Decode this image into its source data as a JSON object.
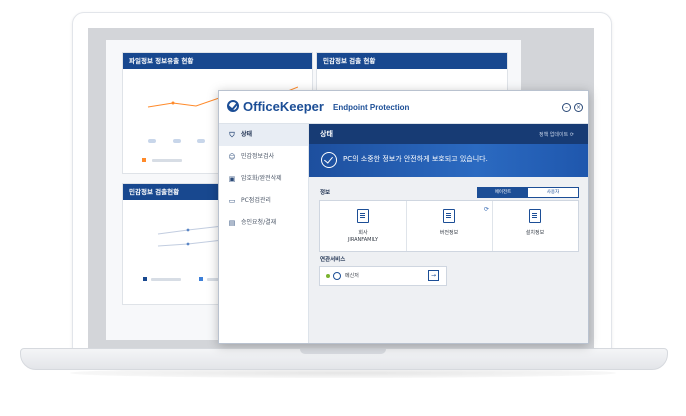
{
  "dashboard": {
    "cards": [
      {
        "title": "파일정보 정보유출 현황"
      },
      {
        "title": "민감정보 검출 현황"
      },
      {
        "title": "민감정보 검출현황"
      }
    ]
  },
  "window": {
    "brand": "OfficeKeeper",
    "brand_sub": "Endpoint Protection",
    "minimize_icon": "minimize-icon",
    "close_icon": "close-icon"
  },
  "sidebar": {
    "items": [
      {
        "label": "상태",
        "icon": "shield-icon",
        "active": true
      },
      {
        "label": "민감정보검사",
        "icon": "users-icon"
      },
      {
        "label": "암호화/완전삭제",
        "icon": "lock-icon"
      },
      {
        "label": "PC점검관리",
        "icon": "monitor-icon"
      },
      {
        "label": "승인요청/결재",
        "icon": "document-icon"
      }
    ]
  },
  "main": {
    "title": "상태",
    "update_label": "정책 업데이트",
    "banner": "PC의 소중한 정보가 안전하게 보호되고 있습니다.",
    "info_label": "정보",
    "tabs": [
      "에이전트",
      "사용자"
    ],
    "info_cells": [
      {
        "line1": "회사",
        "line2": "JIRANFAMILY",
        "icon": "building-icon"
      },
      {
        "line1": "버전정보",
        "line2": "",
        "icon": "version-icon"
      },
      {
        "line1": "설치정보",
        "line2": "",
        "icon": "install-icon"
      }
    ],
    "service_label": "연관서비스",
    "service": {
      "label": "메신저",
      "status_color": "#7ab32f"
    }
  },
  "colors": {
    "primary": "#1c4e96",
    "header": "#173b74",
    "accent": "#ff8a2a"
  }
}
